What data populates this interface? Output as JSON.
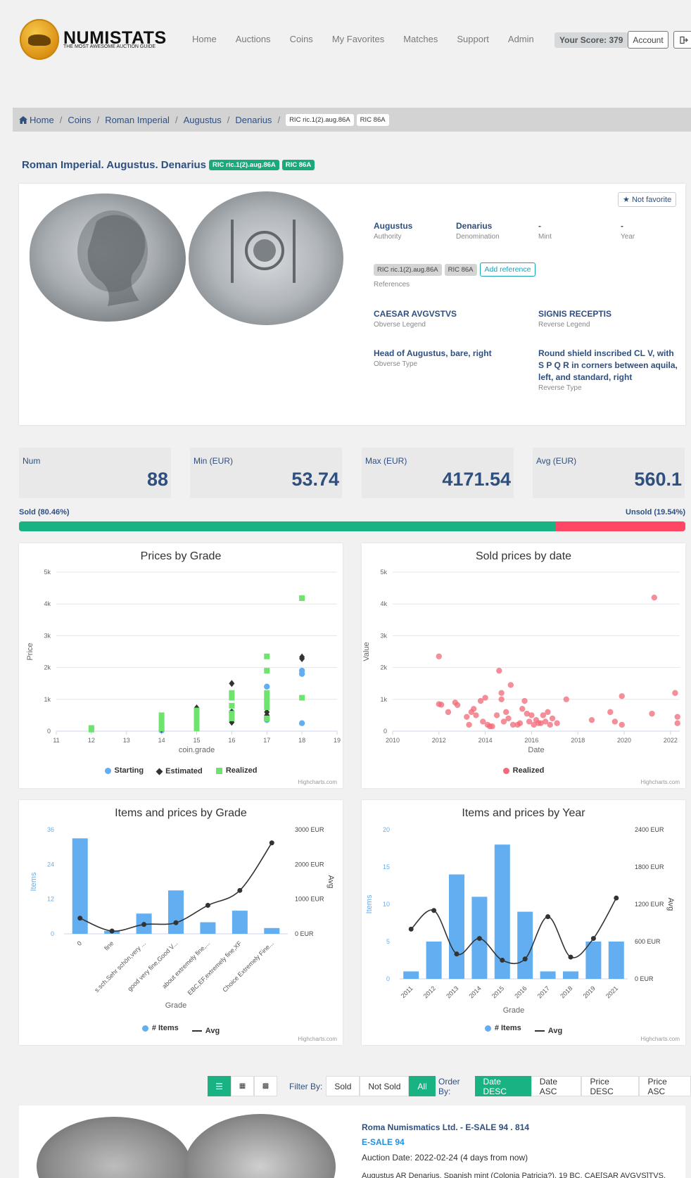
{
  "header": {
    "brand": "NUMISTATS",
    "tagline": "THE MOST AWESOME AUCTION GUIDE",
    "nav": [
      "Home",
      "Auctions",
      "Coins",
      "My Favorites",
      "Matches",
      "Support",
      "Admin"
    ],
    "score": "Your Score: 379",
    "account": "Account",
    "logout_icon": "sign-out-icon"
  },
  "breadcrumb": {
    "items": [
      "Home",
      "Coins",
      "Roman Imperial",
      "Augustus",
      "Denarius"
    ],
    "tags": [
      "RIC ric.1(2).aug.86A",
      "RIC 86A"
    ]
  },
  "coin": {
    "title": "Roman Imperial. Augustus. Denarius",
    "tags": [
      "RIC ric.1(2).aug.86A",
      "RIC 86A"
    ],
    "favorite": "Not favorite",
    "authority": {
      "value": "Augustus",
      "label": "Authority"
    },
    "denomination": {
      "value": "Denarius",
      "label": "Denomination"
    },
    "mint": {
      "value": "-",
      "label": "Mint"
    },
    "year": {
      "value": "-",
      "label": "Year"
    },
    "references": {
      "tags": [
        "RIC ric.1(2).aug.86A",
        "RIC 86A"
      ],
      "add": "Add reference",
      "label": "References"
    },
    "obverse_legend": {
      "value": "CAESAR AVGVSTVS",
      "label": "Obverse Legend"
    },
    "reverse_legend": {
      "value": "SIGNIS RECEPTIS",
      "label": "Reverse Legend"
    },
    "obverse_type": {
      "value": "Head of Augustus, bare, right",
      "label": "Obverse Type"
    },
    "reverse_type": {
      "value": "Round shield inscribed CL V, with S P Q R in corners between aquila, left, and standard, right",
      "label": "Reverse Type"
    }
  },
  "stats": [
    {
      "label": "Num",
      "value": "88"
    },
    {
      "label": "Min (EUR)",
      "value": "53.74"
    },
    {
      "label": "Max (EUR)",
      "value": "4171.54"
    },
    {
      "label": "Avg (EUR)",
      "value": "560.1"
    }
  ],
  "sold": {
    "sold_label": "Sold (80.46%)",
    "unsold_label": "Unsold (19.54%)",
    "sold_pct": 80.46
  },
  "credits": "Highcharts.com",
  "chart_data": [
    {
      "type": "scatter",
      "title": "Prices by Grade",
      "xlabel": "coin.grade",
      "ylabel": "Price",
      "xlim": [
        11,
        19
      ],
      "ylim": [
        0,
        5000
      ],
      "yticks": [
        "0",
        "1k",
        "2k",
        "3k",
        "4k",
        "5k"
      ],
      "xticks": [
        "11",
        "12",
        "13",
        "14",
        "15",
        "16",
        "17",
        "18",
        "19"
      ],
      "series": [
        {
          "name": "Starting",
          "color": "#62aef0",
          "marker": "circle",
          "points": [
            [
              14,
              20
            ],
            [
              16,
              600
            ],
            [
              17,
              1400
            ],
            [
              17,
              400
            ],
            [
              17,
              350
            ],
            [
              18,
              1900
            ],
            [
              18,
              1800
            ],
            [
              18,
              250
            ]
          ]
        },
        {
          "name": "Estimated",
          "color": "#333333",
          "marker": "diamond",
          "points": [
            [
              14,
              60
            ],
            [
              15,
              730
            ],
            [
              16,
              1500
            ],
            [
              16,
              600
            ],
            [
              16,
              280
            ],
            [
              17,
              600
            ],
            [
              17,
              500
            ],
            [
              18,
              2330
            ],
            [
              18,
              2280
            ]
          ]
        },
        {
          "name": "Realized",
          "color": "#6ee36e",
          "marker": "square",
          "points": [
            [
              12,
              100
            ],
            [
              12,
              50
            ],
            [
              14,
              500
            ],
            [
              14,
              350
            ],
            [
              14,
              200
            ],
            [
              14,
              80
            ],
            [
              15,
              650
            ],
            [
              15,
              500
            ],
            [
              15,
              350
            ],
            [
              15,
              200
            ],
            [
              15,
              80
            ],
            [
              16,
              1200
            ],
            [
              16,
              1050
            ],
            [
              16,
              800
            ],
            [
              16,
              550
            ],
            [
              16,
              400
            ],
            [
              17,
              2350
            ],
            [
              17,
              1900
            ],
            [
              17,
              1200
            ],
            [
              17,
              1050
            ],
            [
              17,
              900
            ],
            [
              17,
              750
            ],
            [
              17,
              400
            ],
            [
              18,
              4180
            ],
            [
              18,
              1050
            ]
          ]
        }
      ]
    },
    {
      "type": "scatter",
      "title": "Sold prices by date",
      "xlabel": "Date",
      "ylabel": "Value",
      "xlim": [
        2010,
        2022.4
      ],
      "ylim": [
        0,
        5000
      ],
      "yticks": [
        "0",
        "1k",
        "2k",
        "3k",
        "4k",
        "5k"
      ],
      "xticks": [
        "2010",
        "2012",
        "2014",
        "2016",
        "2018",
        "2020",
        "2022"
      ],
      "series": [
        {
          "name": "Realized",
          "color": "#f06a78",
          "marker": "circle",
          "points": [
            [
              2012.0,
              2350
            ],
            [
              2012.0,
              850
            ],
            [
              2012.1,
              830
            ],
            [
              2012.4,
              600
            ],
            [
              2012.7,
              900
            ],
            [
              2012.8,
              820
            ],
            [
              2013.2,
              450
            ],
            [
              2013.3,
              200
            ],
            [
              2013.4,
              600
            ],
            [
              2013.5,
              700
            ],
            [
              2013.6,
              500
            ],
            [
              2013.8,
              950
            ],
            [
              2013.9,
              300
            ],
            [
              2014.0,
              1050
            ],
            [
              2014.1,
              200
            ],
            [
              2014.2,
              150
            ],
            [
              2014.3,
              150
            ],
            [
              2014.5,
              500
            ],
            [
              2014.6,
              1900
            ],
            [
              2014.7,
              1200
            ],
            [
              2014.7,
              1000
            ],
            [
              2014.8,
              300
            ],
            [
              2014.9,
              600
            ],
            [
              2015.0,
              400
            ],
            [
              2015.1,
              1450
            ],
            [
              2015.2,
              200
            ],
            [
              2015.4,
              200
            ],
            [
              2015.5,
              250
            ],
            [
              2015.6,
              700
            ],
            [
              2015.7,
              950
            ],
            [
              2015.8,
              550
            ],
            [
              2015.9,
              300
            ],
            [
              2016.0,
              500
            ],
            [
              2016.1,
              200
            ],
            [
              2016.2,
              350
            ],
            [
              2016.3,
              250
            ],
            [
              2016.4,
              250
            ],
            [
              2016.5,
              500
            ],
            [
              2016.6,
              300
            ],
            [
              2016.7,
              600
            ],
            [
              2016.8,
              200
            ],
            [
              2016.9,
              400
            ],
            [
              2017.1,
              250
            ],
            [
              2017.5,
              1000
            ],
            [
              2018.6,
              350
            ],
            [
              2019.4,
              600
            ],
            [
              2019.6,
              300
            ],
            [
              2019.9,
              200
            ],
            [
              2019.9,
              1100
            ],
            [
              2021.2,
              550
            ],
            [
              2021.3,
              4200
            ],
            [
              2022.2,
              1200
            ],
            [
              2022.3,
              450
            ],
            [
              2022.3,
              250
            ]
          ]
        }
      ]
    },
    {
      "type": "bar",
      "title": "Items and prices by Grade",
      "xlabel": "Grade",
      "ylabel": "Items",
      "y2label": "Avg",
      "categories": [
        "0",
        "fine",
        "s.sch.Sehr schön,very ...",
        "good very fine,Good V...",
        "about extremely fine,...",
        "EBC,EF,extremely fine,XF",
        "Choice Extremely Fine..."
      ],
      "ylim": [
        0,
        36
      ],
      "yticks": [
        "0",
        "12",
        "24",
        "36"
      ],
      "y2lim": [
        0,
        3000
      ],
      "y2ticks": [
        "0 EUR",
        "1000 EUR",
        "2000 EUR",
        "3000 EUR"
      ],
      "series": [
        {
          "name": "# Items",
          "type": "bar",
          "color": "#62aef0",
          "values": [
            33,
            1,
            7,
            15,
            4,
            8,
            2
          ]
        },
        {
          "name": "Avg",
          "type": "line",
          "color": "#333333",
          "values": [
            450,
            80,
            270,
            320,
            820,
            1250,
            2620
          ]
        }
      ]
    },
    {
      "type": "bar",
      "title": "Items and prices by Year",
      "xlabel": "Grade",
      "ylabel": "Items",
      "y2label": "Avg",
      "categories": [
        "2011",
        "2012",
        "2013",
        "2014",
        "2015",
        "2016",
        "2017",
        "2018",
        "2019",
        "2021"
      ],
      "ylim": [
        0,
        20
      ],
      "yticks": [
        "0",
        "5",
        "10",
        "15",
        "20"
      ],
      "y2lim": [
        0,
        2400
      ],
      "y2ticks": [
        "0 EUR",
        "600 EUR",
        "1200 EUR",
        "1800 EUR",
        "2400 EUR"
      ],
      "series": [
        {
          "name": "# Items",
          "type": "bar",
          "color": "#62aef0",
          "values": [
            1,
            5,
            14,
            11,
            18,
            9,
            1,
            1,
            5,
            5
          ]
        },
        {
          "name": "Avg",
          "type": "line",
          "color": "#333333",
          "values": [
            800,
            1100,
            400,
            650,
            300,
            320,
            1000,
            350,
            650,
            1300
          ]
        }
      ]
    }
  ],
  "toolbar": {
    "filter_label": "Filter By:",
    "filters": [
      "Sold",
      "Not Sold",
      "All"
    ],
    "order_label": "Order By:",
    "orders": [
      "Date DESC",
      "Date ASC",
      "Price DESC",
      "Price ASC"
    ]
  },
  "lot": {
    "house": "Roma Numismatics Ltd. - E-SALE 94 . 814",
    "sale": "E-SALE 94",
    "date": "Auction Date: 2022-02-24 (4 days from now)",
    "desc": "Augustus AR Denarius. Spanish mint (Colonia Patricia?), 19 BC. CAE[SAR AVGVS]TVS,"
  }
}
